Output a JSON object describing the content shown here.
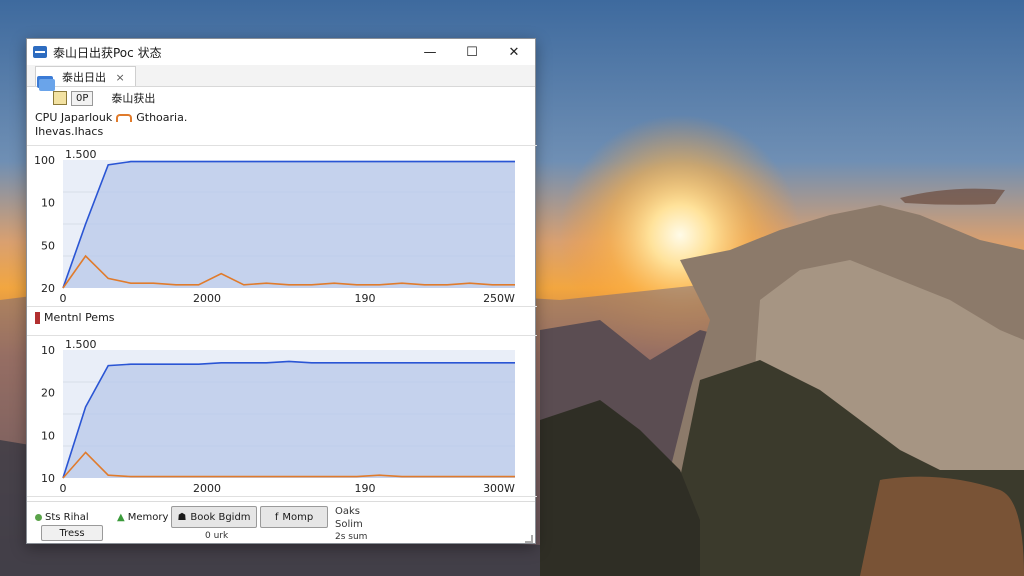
{
  "window": {
    "title": "泰山日出获Poc 状态",
    "controls": {
      "minimize": "—",
      "maximize": "☐",
      "close": "✕"
    }
  },
  "tab": {
    "label": "泰出日出",
    "close": "×"
  },
  "toolbar": {
    "box_label": "0P",
    "label": "泰山获出"
  },
  "cpu_section": {
    "legend_primary": "CPU Japarlouk",
    "legend_secondary": "Gthoaria.",
    "subtitle": "Ihevas.Ihacs"
  },
  "memory_section": {
    "legend": "Mentnl Pems"
  },
  "chart_data": [
    {
      "type": "area",
      "annotation": "1.500",
      "y_ticks": [
        "100",
        "10",
        "50",
        "20"
      ],
      "x_ticks": [
        "0",
        "2000",
        "190",
        "250W"
      ],
      "series": [
        {
          "values": [
            20,
            60,
            97,
            99,
            99,
            99,
            99,
            99,
            99,
            99,
            99,
            99,
            99,
            99,
            99,
            99,
            99,
            99,
            99,
            99,
            99
          ],
          "color": "#2a55d4"
        },
        {
          "values": [
            20,
            40,
            26,
            23,
            23,
            22,
            22,
            29,
            22,
            23,
            22,
            22,
            23,
            22,
            22,
            23,
            22,
            22,
            23,
            22,
            22
          ],
          "color": "#e07b2c"
        }
      ],
      "ylim": [
        20,
        100
      ]
    },
    {
      "type": "area",
      "annotation": "1.500",
      "y_ticks": [
        "10",
        "20",
        "10",
        "10"
      ],
      "x_ticks": [
        "0",
        "2000",
        "190",
        "300W"
      ],
      "series": [
        {
          "values": [
            10,
            60,
            89,
            90,
            90,
            90,
            90,
            91,
            91,
            91,
            92,
            91,
            91,
            91,
            91,
            91,
            91,
            91,
            91,
            91,
            91
          ],
          "color": "#2a55d4"
        },
        {
          "values": [
            10,
            28,
            12,
            11,
            11,
            11,
            11,
            11,
            11,
            11,
            11,
            11,
            11,
            11,
            12,
            11,
            11,
            11,
            11,
            11,
            11
          ],
          "color": "#e07b2c"
        }
      ],
      "ylim": [
        10,
        100
      ]
    }
  ],
  "statusbar": {
    "status_item": "Sts Rihal",
    "memory_item": "Memory",
    "button_back": "Book Bgidm",
    "button_memory": "Momp",
    "right_top": "Oaks",
    "right_bottom": "Solim",
    "tab_label": "Tress",
    "small_under_back": "0 urk",
    "small_right": "2s sum"
  }
}
